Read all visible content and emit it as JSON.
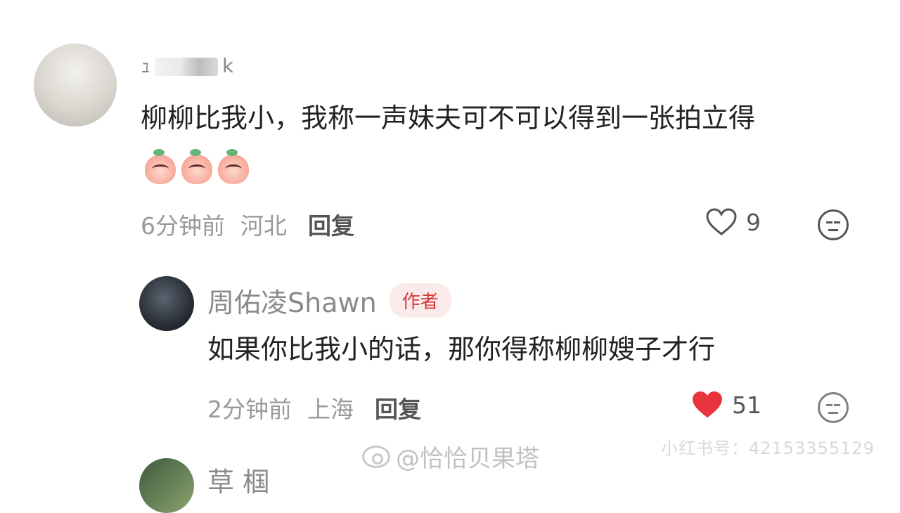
{
  "comment": {
    "username_prefix": "ｭ",
    "username_suffix": "k",
    "text": "柳柳比我小，我称一声妹夫可不可以得到一张拍立得",
    "emoji_count": 3,
    "time": "6分钟前",
    "location": "河北",
    "reply_label": "回复",
    "likes": "9"
  },
  "reply": {
    "username": "周佑凌Shawn",
    "badge": "作者",
    "text": "如果你比我小的话，那你得称柳柳嫂子才行",
    "time": "2分钟前",
    "location": "上海",
    "reply_label": "回复",
    "likes": "51"
  },
  "next_comment": {
    "username_partial": "草 椢"
  },
  "watermarks": {
    "weibo": "@恰恰贝果塔",
    "xiaohongshu": "小红书号：42153355129"
  },
  "colors": {
    "liked_heart": "#e8343f",
    "author_badge_text": "#d23b3b",
    "author_badge_bg": "#fbeaea"
  },
  "icons": {
    "like": "heart-outline-icon",
    "liked": "heart-filled-icon",
    "emoji_reaction": "face-icon"
  }
}
